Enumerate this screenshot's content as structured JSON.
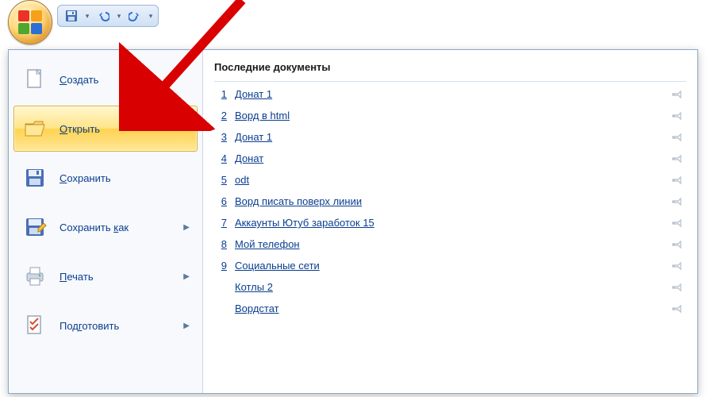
{
  "qat": {
    "save_tooltip": "Сохранить",
    "undo_tooltip": "Отменить",
    "redo_tooltip": "Вернуть"
  },
  "menu": {
    "items": [
      {
        "label": "Создать",
        "icon": "new-doc",
        "selected": false,
        "underline_index": 0,
        "submenu": false
      },
      {
        "label": "Открыть",
        "icon": "open-folder",
        "selected": true,
        "underline_index": 0,
        "submenu": false
      },
      {
        "label": "Сохранить",
        "icon": "save-disk",
        "selected": false,
        "underline_index": 0,
        "submenu": false
      },
      {
        "label": "Сохранить как",
        "icon": "save-as",
        "selected": false,
        "underline_index": 10,
        "submenu": true
      },
      {
        "label": "Печать",
        "icon": "printer",
        "selected": false,
        "underline_index": 0,
        "submenu": true
      },
      {
        "label": "Подготовить",
        "icon": "prepare",
        "selected": false,
        "underline_index": 3,
        "submenu": true
      }
    ]
  },
  "recent": {
    "title": "Последние документы",
    "items": [
      {
        "num": "1",
        "name": "Донат 1"
      },
      {
        "num": "2",
        "name": "Ворд в html"
      },
      {
        "num": "3",
        "name": "Донат 1"
      },
      {
        "num": "4",
        "name": "Донат"
      },
      {
        "num": "5",
        "name": "odt"
      },
      {
        "num": "6",
        "name": "Ворд писать поверх линии"
      },
      {
        "num": "7",
        "name": "Аккаунты Ютуб заработок 15"
      },
      {
        "num": "8",
        "name": "Мой телефон"
      },
      {
        "num": "9",
        "name": "Социальные сети"
      },
      {
        "num": "",
        "name": "Котлы 2"
      },
      {
        "num": "",
        "name": "Вордстат"
      }
    ]
  }
}
